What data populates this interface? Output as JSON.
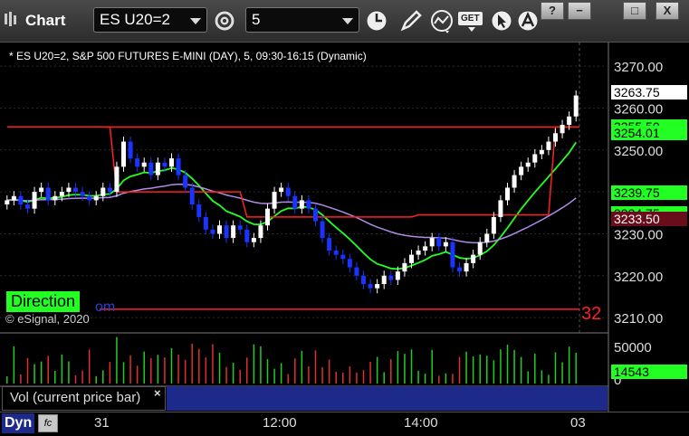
{
  "app": {
    "title": "Chart"
  },
  "toolbar": {
    "symbol_value": "ES U20=2",
    "interval_value": "5",
    "get_label": "GET"
  },
  "window_buttons": {
    "help": "?",
    "restore": "−",
    "maximize": "□",
    "close": "X"
  },
  "chart_header": "* ES U20=2, S&P 500 FUTURES E-MINI (DAY), 5, 09:30-16:15 (Dynamic)",
  "overlay": {
    "direction_label": "Direction",
    "partial_text": "om",
    "copyright": "© eSignal, 2020",
    "right_partial": "32"
  },
  "volume_panel": {
    "legend": "Vol (current price bar)",
    "close": "×"
  },
  "bottom": {
    "dyn_label": "Dyn",
    "fx_label": "fc"
  },
  "colors": {
    "candle_up": "#ffffff",
    "candle_down": "#1a33ff",
    "resistance": "#ff2020",
    "fast_ma": "#22ff22",
    "slow_ma": "#b08ce8",
    "tag_green": "#22ff22",
    "tag_maroon": "#6a0d1a"
  },
  "chart_data": {
    "type": "candlestick",
    "y_axis": {
      "range": [
        3207,
        3275
      ],
      "ticks": [
        "3270.00",
        "3260.00",
        "3250.00",
        "3240.00",
        "3230.00",
        "3220.00",
        "3210.00"
      ]
    },
    "x_axis": {
      "labels": [
        "31",
        "12:00",
        "14:00",
        "03"
      ]
    },
    "price_tags": [
      {
        "label": "3263.75",
        "value": 3263.75,
        "style": "white"
      },
      {
        "label": "3255.50",
        "value": 3255.5,
        "style": "green"
      },
      {
        "label": "3254.01",
        "value": 3254.01,
        "style": "green"
      },
      {
        "label": "3239.75",
        "value": 3239.75,
        "style": "green"
      },
      {
        "label": "3234.75",
        "value": 3234.75,
        "style": "green"
      },
      {
        "label": "3233.50",
        "value": 3233.5,
        "style": "maroon"
      }
    ],
    "volume_axis": {
      "ticks": [
        "50000",
        "0"
      ]
    },
    "volume_tag": "14543",
    "close_series": [
      3238,
      3239,
      3237,
      3236,
      3240,
      3241,
      3238,
      3239,
      3240,
      3241,
      3240,
      3239,
      3238,
      3239,
      3241,
      3240,
      3246,
      3252,
      3248,
      3246,
      3247,
      3244,
      3247,
      3246,
      3248,
      3244,
      3241,
      3237,
      3234,
      3231,
      3230,
      3232,
      3229,
      3232,
      3231,
      3228,
      3229,
      3232,
      3236,
      3240,
      3241,
      3239,
      3236,
      3238,
      3236,
      3233,
      3229,
      3226,
      3225,
      3224,
      3222,
      3220,
      3218,
      3217,
      3218,
      3220,
      3219,
      3221,
      3223,
      3225,
      3226,
      3227,
      3229,
      3227,
      3228,
      3222,
      3221,
      3223,
      3225,
      3228,
      3230,
      3234,
      3238,
      3241,
      3244,
      3246,
      3247,
      3249,
      3250,
      3252,
      3254,
      3256,
      3258,
      3263
    ]
  }
}
